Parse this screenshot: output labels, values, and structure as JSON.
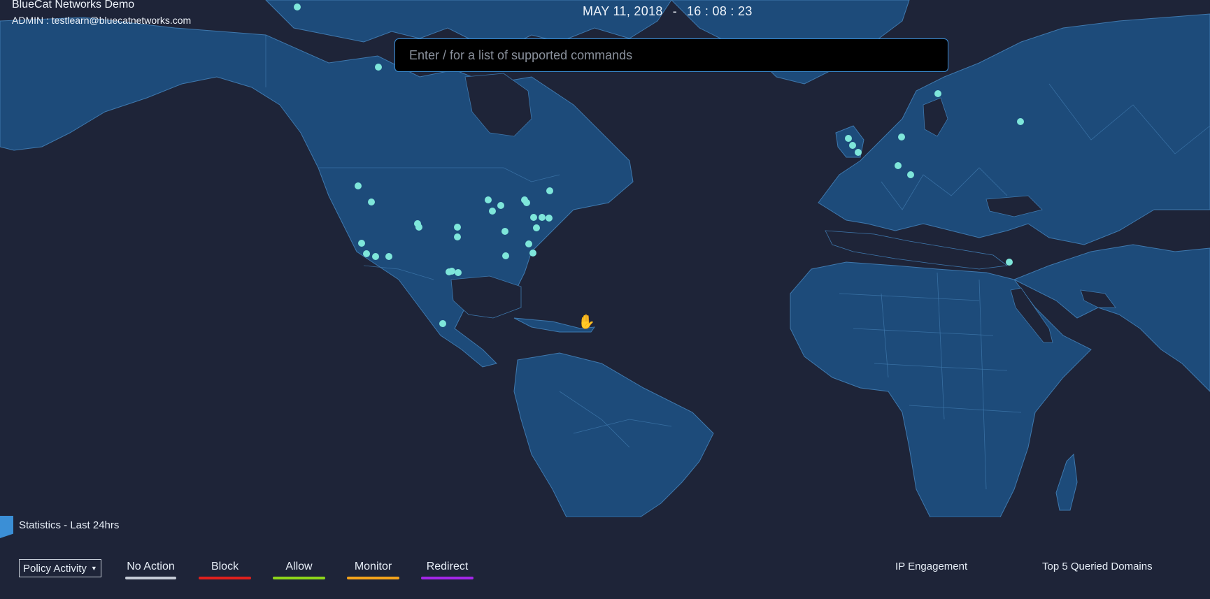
{
  "header": {
    "org_name": "BlueCat Networks Demo",
    "admin_line": "ADMIN : testlearn@bluecatnetworks.com",
    "date": "MAY 11, 2018",
    "separator": "-",
    "time": "16 : 08 : 23"
  },
  "command_bar": {
    "placeholder": "Enter / for a list of supported commands",
    "value": ""
  },
  "map": {
    "colors": {
      "land": "#1d4b7a",
      "ocean": "#1e2438",
      "border": "#3f78ad",
      "marker": "#7ee6da"
    }
  },
  "statistics": {
    "title": "Statistics - Last 24hrs",
    "filter": {
      "selected": "Policy Activity"
    },
    "legend": [
      {
        "label": "No Action",
        "color": "#c5cbd6"
      },
      {
        "label": "Block",
        "color": "#e0201d"
      },
      {
        "label": "Allow",
        "color": "#8ed61a"
      },
      {
        "label": "Monitor",
        "color": "#f4a31b"
      },
      {
        "label": "Redirect",
        "color": "#a326e8"
      }
    ],
    "links": {
      "ip_engagement": "IP Engagement",
      "top_domains": "Top 5 Queried Domains"
    }
  }
}
